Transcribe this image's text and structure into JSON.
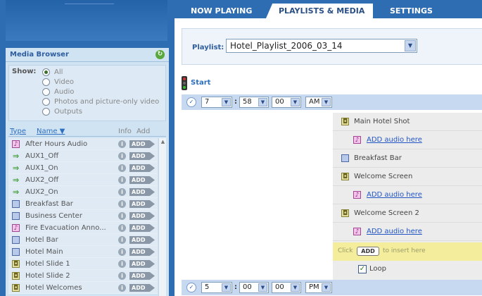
{
  "tabs": [
    {
      "label": "NOW PLAYING",
      "active": false
    },
    {
      "label": "PLAYLISTS & MEDIA",
      "active": true
    },
    {
      "label": "SETTINGS",
      "active": false
    }
  ],
  "media_browser": {
    "title": "Media Browser",
    "refresh_icon": "refresh-icon",
    "show_label": "Show:",
    "show_options": [
      {
        "label": "All",
        "selected": true
      },
      {
        "label": "Video",
        "selected": false
      },
      {
        "label": "Audio",
        "selected": false
      },
      {
        "label": "Photos and picture-only video",
        "selected": false
      },
      {
        "label": "Outputs",
        "selected": false
      }
    ],
    "columns": {
      "type": "Type",
      "name": "Name ▼",
      "info": "Info",
      "add": "Add"
    },
    "add_label": "ADD",
    "items": [
      {
        "type": "audio",
        "name": "After Hours Audio"
      },
      {
        "type": "output",
        "name": "AUX1_Off"
      },
      {
        "type": "output",
        "name": "AUX1_On"
      },
      {
        "type": "output",
        "name": "AUX2_Off"
      },
      {
        "type": "output",
        "name": "AUX2_On"
      },
      {
        "type": "mosaic",
        "name": "Breakfast Bar"
      },
      {
        "type": "mosaic",
        "name": "Business Center"
      },
      {
        "type": "audio",
        "name": "Fire Evacuation Anno..."
      },
      {
        "type": "mosaic",
        "name": "Hotel Bar"
      },
      {
        "type": "mosaic",
        "name": "Hotel Main"
      },
      {
        "type": "photo",
        "name": "Hotel Slide 1"
      },
      {
        "type": "photo",
        "name": "Hotel Slide 2"
      },
      {
        "type": "photo",
        "name": "Hotel Welcomes"
      }
    ]
  },
  "playlist": {
    "label": "Playlist:",
    "value": "Hotel_Playlist_2006_03_14"
  },
  "start_label": "Start",
  "time_start": {
    "hour": "7",
    "minute": "58",
    "second": "00",
    "ampm": "AM"
  },
  "time_end": {
    "hour": "5",
    "minute": "00",
    "second": "00",
    "ampm": "PM"
  },
  "slots": {
    "main_hotel_shot": "Main Hotel Shot",
    "add_audio_1": "ADD audio here",
    "breakfast_bar": "Breakfast Bar",
    "welcome_screen": "Welcome Screen",
    "add_audio_2": "ADD audio here",
    "welcome_screen_2": "Welcome Screen 2",
    "add_audio_3": "ADD audio here",
    "click_text": "Click",
    "click_add": "ADD",
    "click_text2": "to insert here",
    "loop_label": "Loop",
    "loop_checked": true
  }
}
